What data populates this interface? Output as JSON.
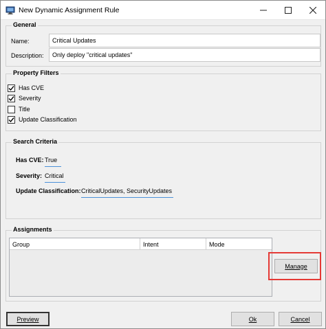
{
  "window": {
    "title": "New Dynamic Assignment Rule"
  },
  "general": {
    "title": "General",
    "name_label": "Name:",
    "name_value": "Critical Updates",
    "description_label": "Description:",
    "description_value": "Only deploy \"critical updates\""
  },
  "property_filters": {
    "title": "Property Filters",
    "items": [
      {
        "label": "Has CVE",
        "checked": true
      },
      {
        "label": "Severity",
        "checked": true
      },
      {
        "label": "Title",
        "checked": false
      },
      {
        "label": "Update Classification",
        "checked": true
      }
    ]
  },
  "search_criteria": {
    "title": "Search Criteria",
    "has_cve_label": "Has CVE:",
    "has_cve_value": "True",
    "severity_label": "Severity:",
    "severity_value": "Critical",
    "classification_label": "Update Classification:",
    "classification_value": "CriticalUpdates, SecurityUpdates"
  },
  "assignments": {
    "title": "Assignments",
    "columns": [
      "Group",
      "Intent",
      "Mode"
    ],
    "rows": [],
    "manage_label": "Manage"
  },
  "footer": {
    "preview_label": "Preview",
    "ok_label": "Ok",
    "cancel_label": "Cancel"
  },
  "colors": {
    "highlight": "#e53935",
    "accent_underline": "#4a90d9",
    "check": "#000000"
  }
}
